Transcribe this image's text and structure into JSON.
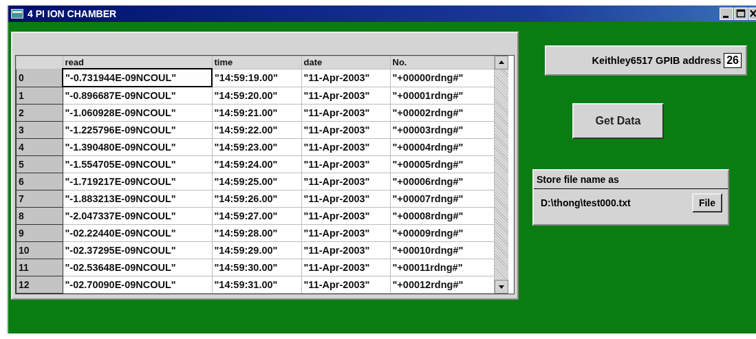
{
  "window": {
    "title": "4 PI ION CHAMBER"
  },
  "table": {
    "columns": [
      "read",
      "time",
      "date",
      "No."
    ],
    "rows": [
      {
        "index": "0",
        "focused": true,
        "cells": [
          "\"-0.731944E-09NCOUL\"",
          "\"14:59:19.00\"",
          "\"11-Apr-2003\"",
          "\"+00000rdng#\""
        ]
      },
      {
        "index": "1",
        "focused": false,
        "cells": [
          "\"-0.896687E-09NCOUL\"",
          "\"14:59:20.00\"",
          "\"11-Apr-2003\"",
          "\"+00001rdng#\""
        ]
      },
      {
        "index": "2",
        "focused": false,
        "cells": [
          "\"-1.060928E-09NCOUL\"",
          "\"14:59:21.00\"",
          "\"11-Apr-2003\"",
          "\"+00002rdng#\""
        ]
      },
      {
        "index": "3",
        "focused": false,
        "cells": [
          "\"-1.225796E-09NCOUL\"",
          "\"14:59:22.00\"",
          "\"11-Apr-2003\"",
          "\"+00003rdng#\""
        ]
      },
      {
        "index": "4",
        "focused": false,
        "cells": [
          "\"-1.390480E-09NCOUL\"",
          "\"14:59:23.00\"",
          "\"11-Apr-2003\"",
          "\"+00004rdng#\""
        ]
      },
      {
        "index": "5",
        "focused": false,
        "cells": [
          "\"-1.554705E-09NCOUL\"",
          "\"14:59:24.00\"",
          "\"11-Apr-2003\"",
          "\"+00005rdng#\""
        ]
      },
      {
        "index": "6",
        "focused": false,
        "cells": [
          "\"-1.719217E-09NCOUL\"",
          "\"14:59:25.00\"",
          "\"11-Apr-2003\"",
          "\"+00006rdng#\""
        ]
      },
      {
        "index": "7",
        "focused": false,
        "cells": [
          "\"-1.883213E-09NCOUL\"",
          "\"14:59:26.00\"",
          "\"11-Apr-2003\"",
          "\"+00007rdng#\""
        ]
      },
      {
        "index": "8",
        "focused": false,
        "cells": [
          "\"-2.047337E-09NCOUL\"",
          "\"14:59:27.00\"",
          "\"11-Apr-2003\"",
          "\"+00008rdng#\""
        ]
      },
      {
        "index": "9",
        "focused": false,
        "cells": [
          "\"-02.22440E-09NCOUL\"",
          "\"14:59:28.00\"",
          "\"11-Apr-2003\"",
          "\"+00009rdng#\""
        ]
      },
      {
        "index": "10",
        "focused": false,
        "cells": [
          "\"-02.37295E-09NCOUL\"",
          "\"14:59:29.00\"",
          "\"11-Apr-2003\"",
          "\"+00010rdng#\""
        ]
      },
      {
        "index": "11",
        "focused": false,
        "cells": [
          "\"-02.53648E-09NCOUL\"",
          "\"14:59:30.00\"",
          "\"11-Apr-2003\"",
          "\"+00011rdng#\""
        ]
      },
      {
        "index": "12",
        "focused": false,
        "cells": [
          "\"-02.70090E-09NCOUL\"",
          "\"14:59:31.00\"",
          "\"11-Apr-2003\"",
          "\"+00012rdng#\""
        ]
      }
    ]
  },
  "gpib": {
    "label": "Keithley6517 GPIB address",
    "value": "26"
  },
  "get_data_button": "Get Data",
  "store": {
    "label": "Store file name as",
    "path": "D:\\thong\\test000.txt",
    "button": "File"
  }
}
